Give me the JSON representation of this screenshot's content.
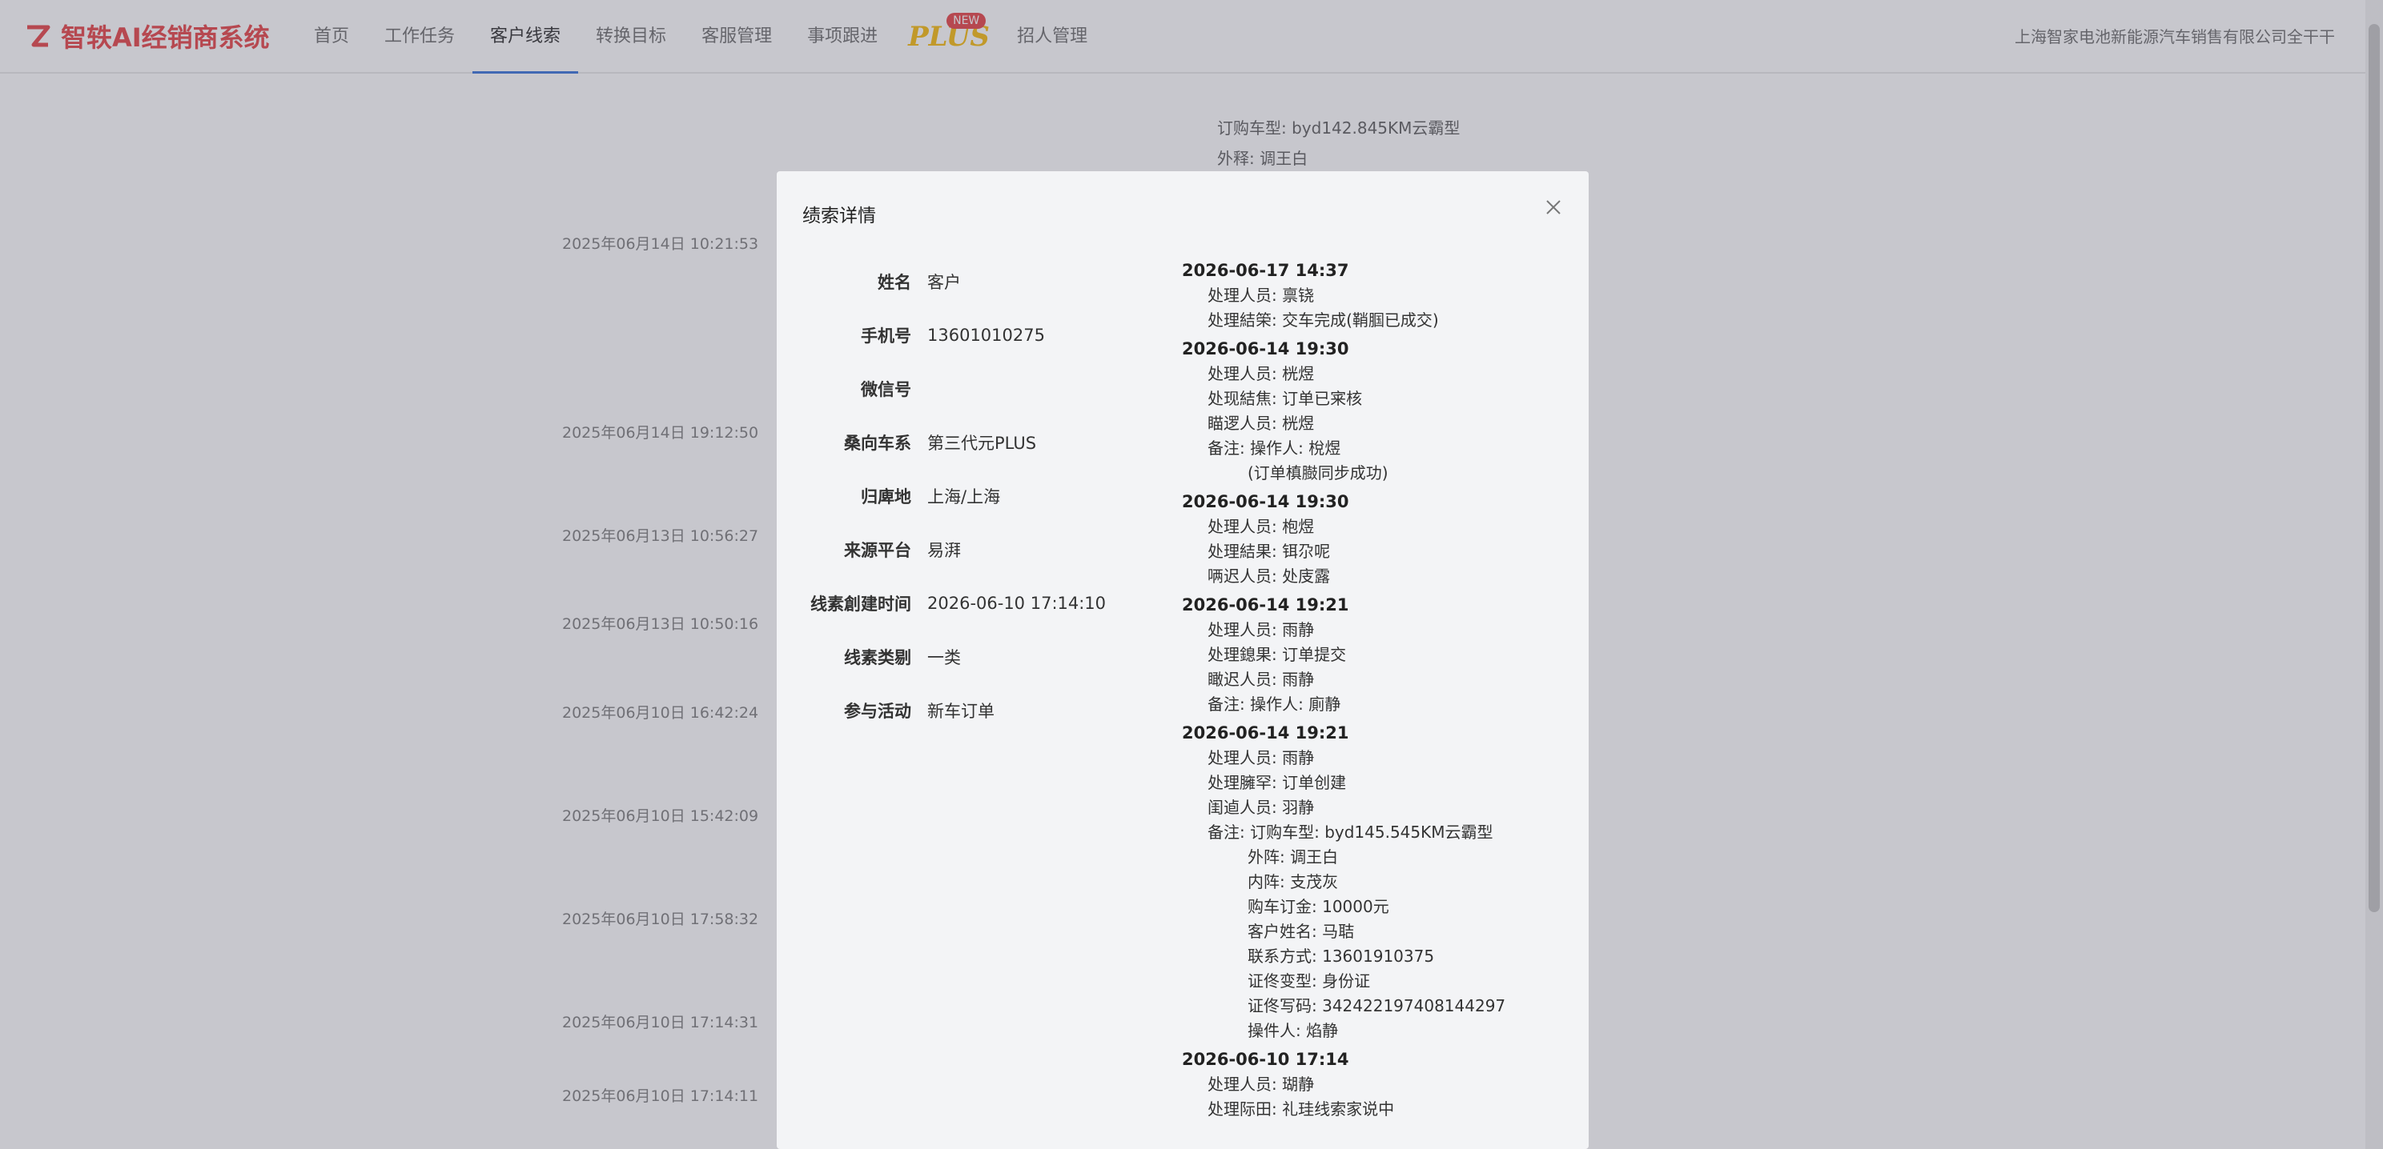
{
  "app": {
    "brand": "智轶AI经销商系统",
    "nav": [
      "首页",
      "工作任务",
      "客户线索",
      "转换目标",
      "客服管理",
      "事项跟进",
      "招人管理"
    ],
    "active_nav": "客户线索",
    "promo_badge": "NEW",
    "promo_logo": "PLUS",
    "dealer": "上海智家电池新能源汽车销售有限公司全干干"
  },
  "background": {
    "note_line1": "订购车型: byd142.845KM云霸型",
    "note_line2": "外释: 调王白",
    "dates": [
      "2025年06月14日 10:21:53",
      "2025年06月14日 19:12:50",
      "2025年06月13日 10:56:27",
      "2025年06月13日 10:50:16",
      "2025年06月10日 16:42:24",
      "2025年06月10日 15:42:09",
      "2025年06月10日 17:58:32",
      "2025年06月10日 17:14:31",
      "2025年06月10日 17:14:11"
    ]
  },
  "modal": {
    "title": "绩索详情",
    "info": [
      {
        "label": "姓名",
        "value": "客户"
      },
      {
        "label": "手机号",
        "value": "13601010275"
      },
      {
        "label": "微信号",
        "value": ""
      },
      {
        "label": "桑向车系",
        "value": "第三代元PLUS"
      },
      {
        "label": "归庳地",
        "value": "上海/上海"
      },
      {
        "label": "来源平台",
        "value": "易湃"
      },
      {
        "label": "线素創建时间",
        "value": "2026-06-10 17:14:10"
      },
      {
        "label": "线素类剔",
        "value": "一类"
      },
      {
        "label": "参与活动",
        "value": "新车订单"
      }
    ],
    "logs": [
      {
        "time": "2026-06-17 14:37",
        "lines": [
          {
            "text": "处理人员: 禀铙",
            "sub": false
          },
          {
            "text": "处理結筞: 交车完成(鞘腘已成交)",
            "sub": false
          }
        ]
      },
      {
        "time": "2026-06-14 19:30",
        "lines": [
          {
            "text": "处理人员: 桄煜",
            "sub": false
          },
          {
            "text": "处现結焦: 订单已宷核",
            "sub": false
          },
          {
            "text": "瞄逻人员: 桄煜",
            "sub": false
          },
          {
            "text": "备注: 操作人: 梲煜",
            "sub": false
          },
          {
            "text": "(订单槙臌同步成功)",
            "sub": true
          }
        ]
      },
      {
        "time": "2026-06-14 19:30",
        "lines": [
          {
            "text": "处理人员: 枹煜",
            "sub": false
          },
          {
            "text": "处理結果: 铒尕呢",
            "sub": false
          },
          {
            "text": "唡迟人员: 处庋露",
            "sub": false
          }
        ]
      },
      {
        "time": "2026-06-14 19:21",
        "lines": [
          {
            "text": "处理人员: 雨静",
            "sub": false
          },
          {
            "text": "处理鎴果: 订单提交",
            "sub": false
          },
          {
            "text": "瞰迟人员: 雨静",
            "sub": false
          },
          {
            "text": "备注: 操作人: 廁静",
            "sub": false
          }
        ]
      },
      {
        "time": "2026-06-14 19:21",
        "lines": [
          {
            "text": "处理人员: 雨静",
            "sub": false
          },
          {
            "text": "处理臃罕: 订单创建",
            "sub": false
          },
          {
            "text": "闺逌人员: 羽静",
            "sub": false
          },
          {
            "text": "备注: 订购车型: byd145.545KM云霸型",
            "sub": false
          },
          {
            "text": "外阵: 调王白",
            "sub": true
          },
          {
            "text": "内阵: 支茂灰",
            "sub": true
          },
          {
            "text": "购车订金: 10000元",
            "sub": true
          },
          {
            "text": "客户姓名: 马聐",
            "sub": true
          },
          {
            "text": "联系方式: 13601910375",
            "sub": true
          },
          {
            "text": "证佟变型: 身份证",
            "sub": true
          },
          {
            "text": "证佟写码: 342422197408144297",
            "sub": true
          },
          {
            "text": "操件人: 焰静",
            "sub": true
          }
        ]
      },
      {
        "time": "2026-06-10 17:14",
        "lines": [
          {
            "text": "处理人员: 瑚静",
            "sub": false
          },
          {
            "text": "处理际田: 礼珪线索家说中",
            "sub": false
          }
        ]
      }
    ]
  }
}
